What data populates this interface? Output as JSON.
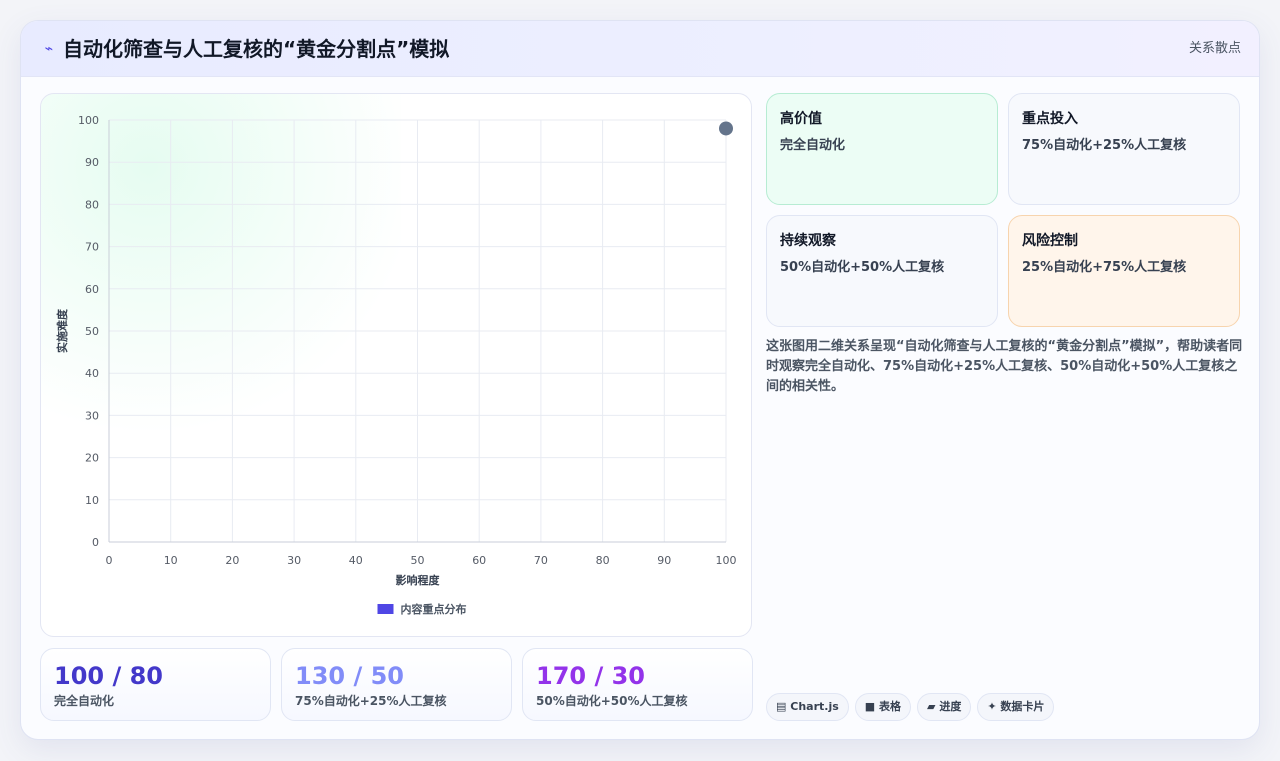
{
  "header": {
    "icon": "bolt-icon",
    "icon_glyph": "⌁",
    "title": "自动化筛查与人工复核的“黄金分割点”模拟",
    "tag": "关系散点"
  },
  "chart_data": {
    "type": "scatter",
    "xlabel": "影响程度",
    "ylabel": "实施难度",
    "xlim": [
      0,
      100
    ],
    "ylim": [
      0,
      100
    ],
    "xticks": [
      "0",
      "10",
      "20",
      "30",
      "40",
      "50",
      "60",
      "70",
      "80",
      "90",
      "100"
    ],
    "yticks": [
      "0",
      "10",
      "20",
      "30",
      "40",
      "50",
      "60",
      "70",
      "80",
      "90",
      "100"
    ],
    "grid": true,
    "legend_position": "bottom",
    "series": [
      {
        "name": "内容重点分布",
        "color": "#4f46e5",
        "point_color": "#64748b",
        "points": [
          {
            "x": 100,
            "y": 98
          }
        ]
      }
    ]
  },
  "quadrants": [
    {
      "title": "高价值",
      "desc": "完全自动化",
      "tone": "green"
    },
    {
      "title": "重点投入",
      "desc": "75%自动化+25%人工复核",
      "tone": "neutral"
    },
    {
      "title": "持续观察",
      "desc": "50%自动化+50%人工复核",
      "tone": "neutral"
    },
    {
      "title": "风险控制",
      "desc": "25%自动化+75%人工复核",
      "tone": "orange"
    }
  ],
  "description": "这张图用二维关系呈现“自动化筛查与人工复核的“黄金分割点”模拟”，帮助读者同时观察完全自动化、75%自动化+25%人工复核、50%自动化+50%人工复核之间的相关性。",
  "stats": [
    {
      "value": "100 / 80",
      "label": "完全自动化",
      "color": "#4338ca"
    },
    {
      "value": "130 / 50",
      "label": "75%自动化+25%人工复核",
      "color": "#818cf8"
    },
    {
      "value": "170 / 30",
      "label": "50%自动化+50%人工复核",
      "color": "#9333ea"
    }
  ],
  "chips": [
    {
      "glyph": "▤",
      "label": "Chart.js",
      "icon": "chart-icon"
    },
    {
      "glyph": "■",
      "label": "表格",
      "icon": "table-icon"
    },
    {
      "glyph": "▰",
      "label": "进度",
      "icon": "progress-icon"
    },
    {
      "glyph": "✦",
      "label": "数据卡片",
      "icon": "sparkle-icon"
    }
  ]
}
